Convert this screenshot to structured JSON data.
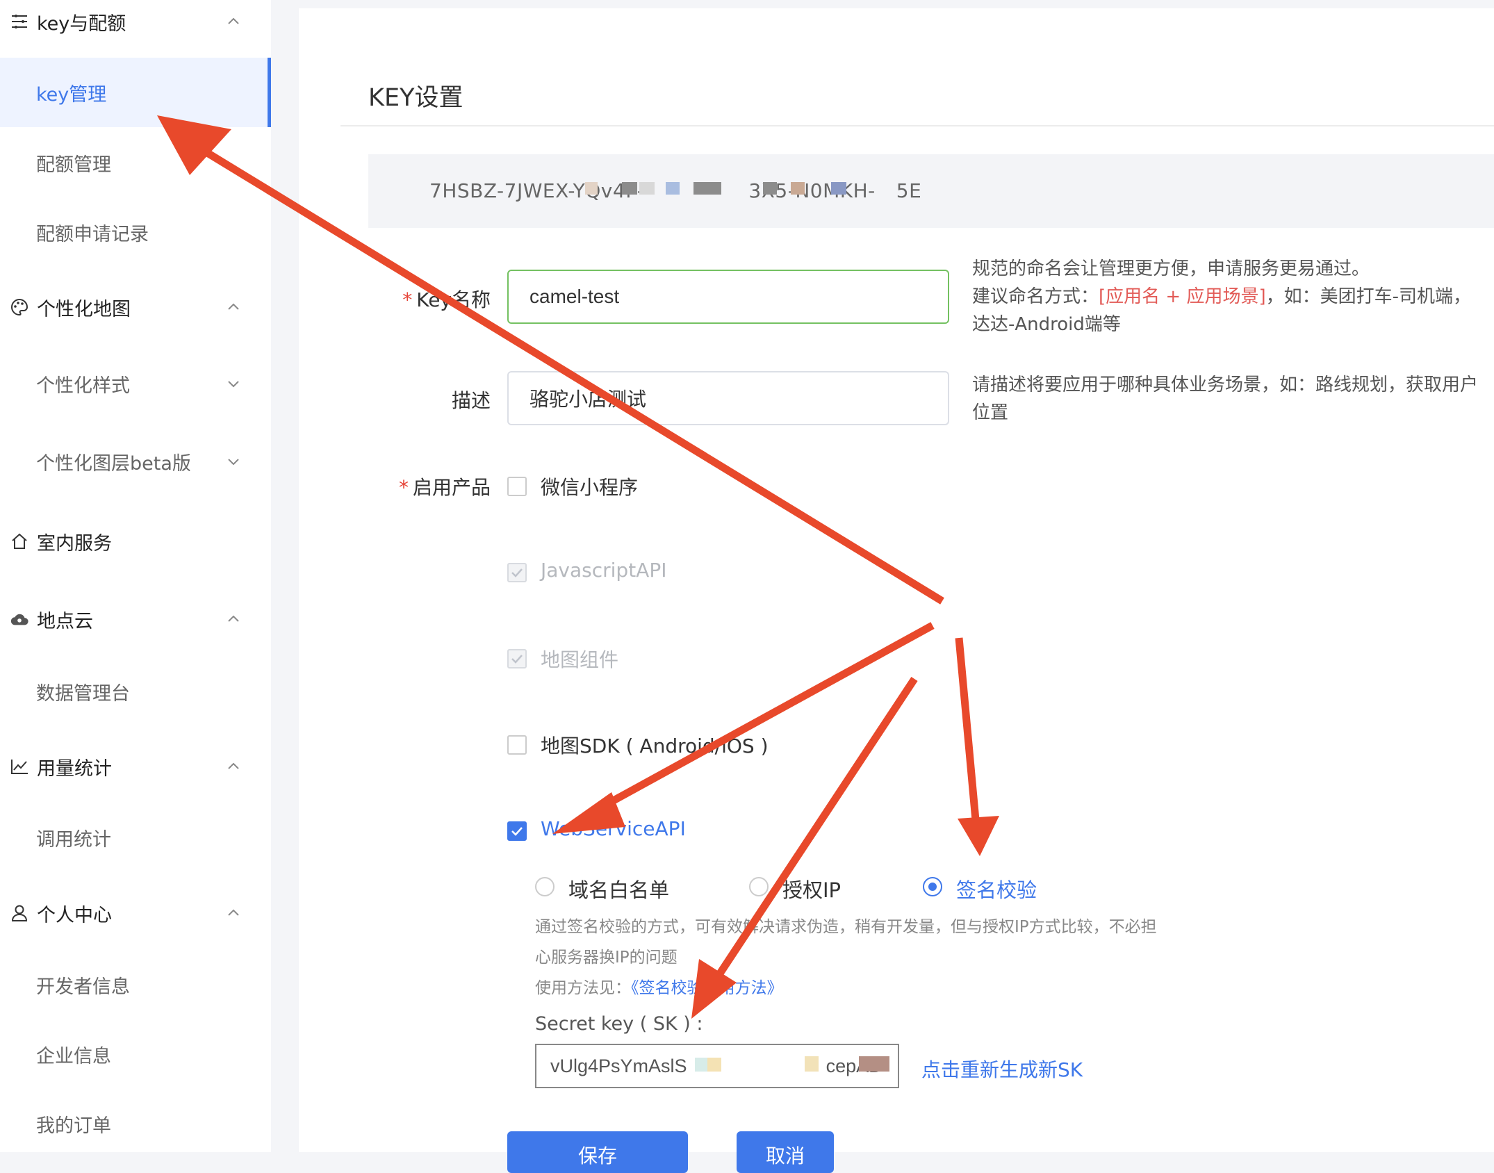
{
  "sidebar": {
    "groups": [
      {
        "label": "key与配额",
        "icon": "list-icon",
        "expanded": true
      },
      {
        "label": "个性化地图",
        "icon": "palette-icon",
        "expanded": true
      },
      {
        "label": "室内服务",
        "icon": "home-icon"
      },
      {
        "label": "地点云",
        "icon": "cloud-icon",
        "expanded": true
      },
      {
        "label": "用量统计",
        "icon": "chart-icon",
        "expanded": true
      },
      {
        "label": "个人中心",
        "icon": "user-icon",
        "expanded": true
      }
    ],
    "items": [
      {
        "label": "key管理",
        "active": true
      },
      {
        "label": "配额管理"
      },
      {
        "label": "配额申请记录"
      },
      {
        "label": "个性化样式"
      },
      {
        "label": "个性化图层beta版"
      },
      {
        "label": "数据管理台"
      },
      {
        "label": "调用统计"
      },
      {
        "label": "开发者信息"
      },
      {
        "label": "企业信息"
      },
      {
        "label": "我的订单"
      }
    ]
  },
  "page": {
    "title": "KEY设置",
    "key_value": "7HSBZ-7JWEX-YQv4F-",
    "key_value_tail": "3X5-N0MKH-",
    "key_value_end": "5E"
  },
  "form": {
    "key_name_label": "Key名称",
    "key_name_value": "camel-test",
    "key_name_hint_1": "规范的命名会让管理更方便，申请服务更易通过。",
    "key_name_hint_2a": "建议命名方式：",
    "key_name_hint_2b": "[应用名 + 应用场景]",
    "key_name_hint_2c": "，如：美团打车-司机端，达达-Android端等",
    "desc_label": "描述",
    "desc_value": "骆驼小店测试",
    "desc_hint": "请描述将要应用于哪种具体业务场景，如：路线规划，获取用户位置",
    "products_label": "启用产品",
    "products": [
      {
        "label": "微信小程序",
        "state": "unchecked"
      },
      {
        "label": "JavascriptAPI",
        "state": "checked-disabled"
      },
      {
        "label": "地图组件",
        "state": "checked-disabled"
      },
      {
        "label": "地图SDK ( Android/iOS )",
        "state": "unchecked"
      },
      {
        "label": "WebServiceAPI",
        "state": "checked"
      }
    ],
    "auth_options": [
      {
        "label": "域名白名单",
        "selected": false
      },
      {
        "label": "授权IP",
        "selected": false
      },
      {
        "label": "签名校验",
        "selected": true
      }
    ],
    "sign_desc": "通过签名校验的方式，可有效解决请求伪造，稍有开发量，但与授权IP方式比较，不必担心服务器换IP的问题",
    "usage_prefix": "使用方法见：",
    "usage_link": "《签名校验使用方法》",
    "sk_label": "Secret key ( SK ) :",
    "sk_value": "vUlg4PsYmAslS",
    "sk_tail": "cepAD",
    "regen_link": "点击重新生成新SK",
    "save_label": "保存",
    "cancel_label": "取消"
  },
  "colors": {
    "accent": "#3f78ea",
    "annotation_arrow": "#e8492b",
    "required": "#e6463a",
    "focus_border": "#74c161"
  }
}
